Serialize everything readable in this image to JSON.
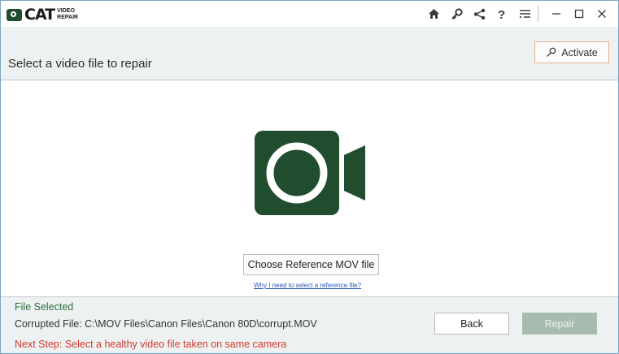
{
  "app": {
    "logo_main": "CAT",
    "logo_sub_1": "VIDEO",
    "logo_sub_2": "REPAIR"
  },
  "toolbar": {
    "icons": [
      "home-icon",
      "key-icon",
      "share-icon",
      "help-icon",
      "menu-icon",
      "minimize-icon",
      "maximize-icon",
      "close-icon"
    ]
  },
  "header": {
    "title": "Select a video file to repair",
    "activate_label": "Activate"
  },
  "main": {
    "choose_label": "Choose Reference MOV file",
    "why_link": "Why I need to select a reference file?"
  },
  "status": {
    "file_selected": "File Selected",
    "corrupted_file": "Corrupted File: C:\\MOV Files\\Canon Files\\Canon 80D\\corrupt.MOV",
    "next_step": "Next Step: Select a healthy video file taken on same camera"
  },
  "actions": {
    "back_label": "Back",
    "repair_label": "Repair"
  },
  "colors": {
    "brand_green": "#1f4d2e",
    "next_step_red": "#d33a2c",
    "file_selected_green": "#2f6f3a",
    "activate_border": "#e0b385"
  }
}
